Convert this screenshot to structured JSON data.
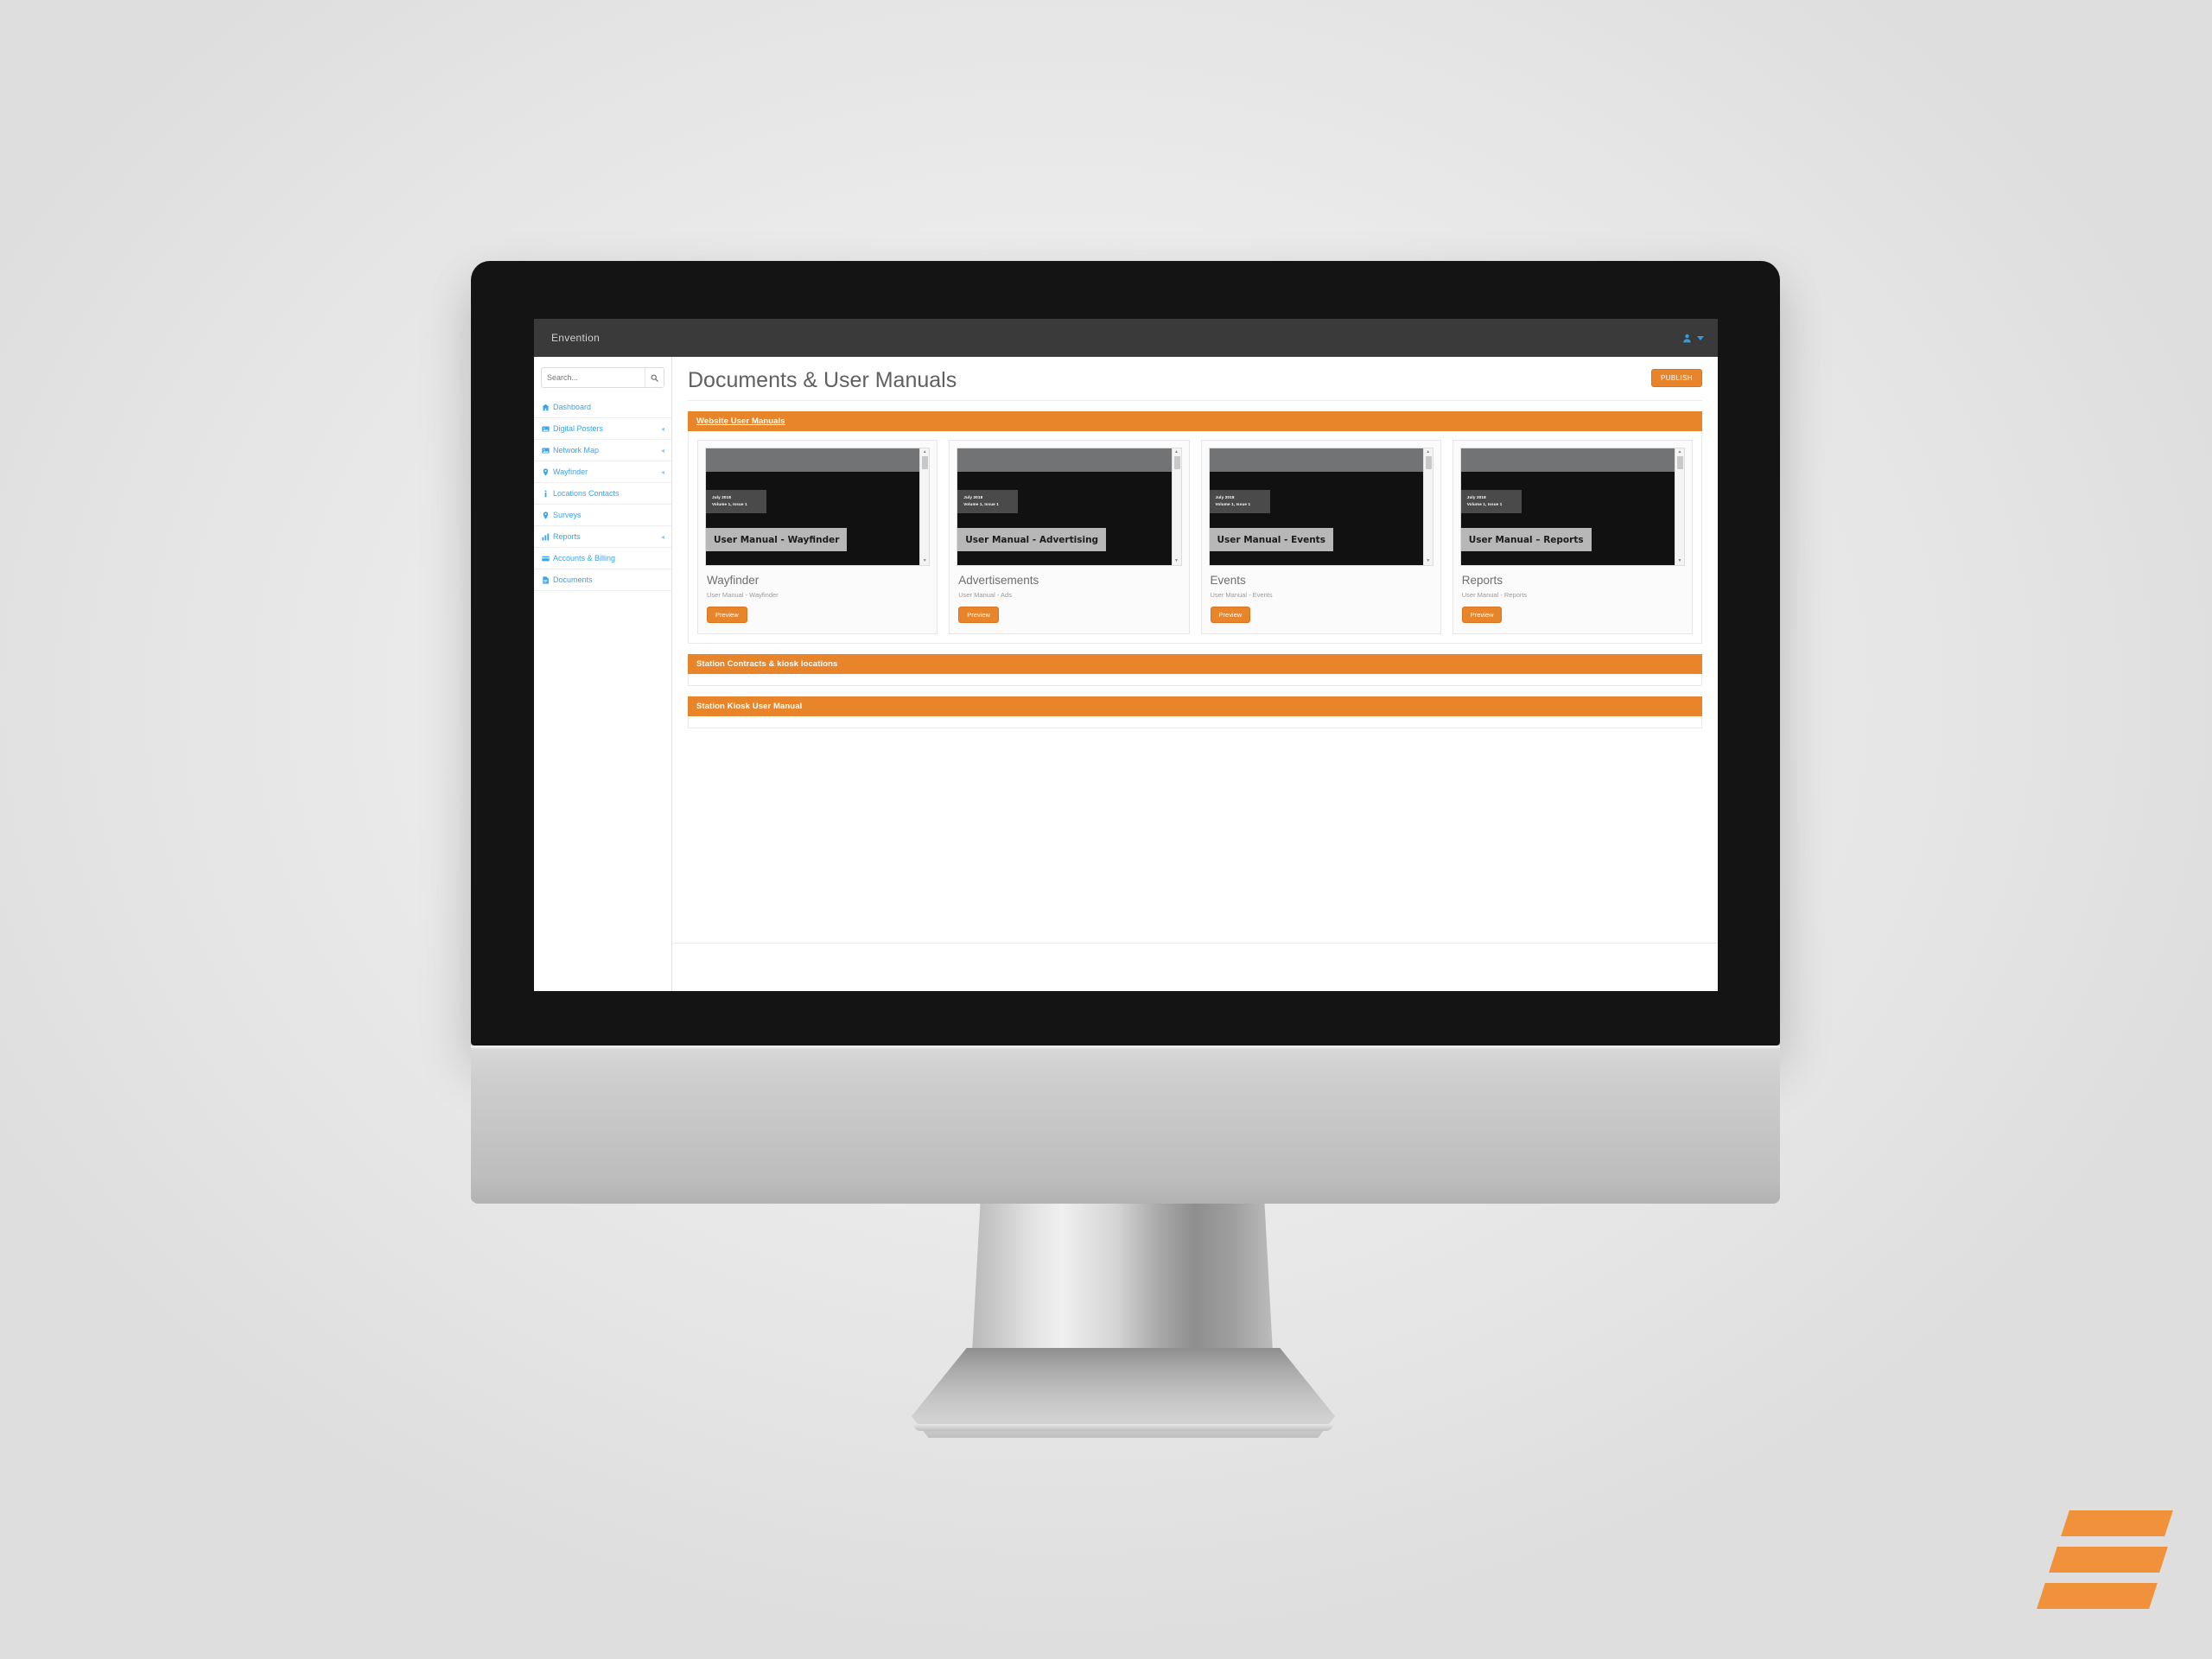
{
  "topnav": {
    "brand": "Envention",
    "user_icon": "user-icon",
    "caret_icon": "chevron-down-icon"
  },
  "sidebar": {
    "search": {
      "placeholder": "Search...",
      "value": "",
      "icon": "search-icon"
    },
    "items": [
      {
        "label": "Dashboard",
        "icon": "home-icon",
        "expandable": false
      },
      {
        "label": "Digital Posters",
        "icon": "image-icon",
        "expandable": true
      },
      {
        "label": "Network Map",
        "icon": "image-icon",
        "expandable": true
      },
      {
        "label": "Wayfinder",
        "icon": "pin-icon",
        "expandable": true
      },
      {
        "label": "Locations Contacts",
        "icon": "info-icon",
        "expandable": false
      },
      {
        "label": "Surveys",
        "icon": "pin-icon",
        "expandable": false
      },
      {
        "label": "Reports",
        "icon": "chart-icon",
        "expandable": true
      },
      {
        "label": "Accounts & Billing",
        "icon": "card-icon",
        "expandable": false
      },
      {
        "label": "Documents",
        "icon": "document-icon",
        "expandable": false
      }
    ]
  },
  "page": {
    "title": "Documents & User Manuals",
    "publish_label": "PUBLISH"
  },
  "panels": [
    {
      "heading": "Website User Manuals",
      "underlined": true
    },
    {
      "heading": "Station Contracts & kiosk locations",
      "underlined": false
    },
    {
      "heading": "Station Kiosk User Manual",
      "underlined": false
    }
  ],
  "cards": [
    {
      "thumb_title": "User Manual - Wayfinder",
      "thumb_date": "July 2018",
      "thumb_volume": "Volume 1, Issue 1",
      "title": "Wayfinder",
      "subtitle": "User Manual - Wayfinder",
      "button": "Preview"
    },
    {
      "thumb_title": "User Manual - Advertising",
      "thumb_date": "July 2018",
      "thumb_volume": "Volume 1, Issue 1",
      "title": "Advertisements",
      "subtitle": "User Manual - Ads",
      "button": "Preview"
    },
    {
      "thumb_title": "User Manual - Events",
      "thumb_date": "July 2018",
      "thumb_volume": "Volume 1, Issue 1",
      "title": "Events",
      "subtitle": "User Manual - Events",
      "button": "Preview"
    },
    {
      "thumb_title": "User Manual – Reports",
      "thumb_date": "July 2018",
      "thumb_volume": "Volume 1, Issue 1",
      "title": "Reports",
      "subtitle": "User Manual - Reports",
      "button": "Preview"
    }
  ],
  "colors": {
    "accent_orange": "#e8842a",
    "link_blue": "#3ba3e8",
    "topnav_dark": "#3a3a3a",
    "title_gray": "#5f6062",
    "logo_orange": "#f2913c"
  }
}
